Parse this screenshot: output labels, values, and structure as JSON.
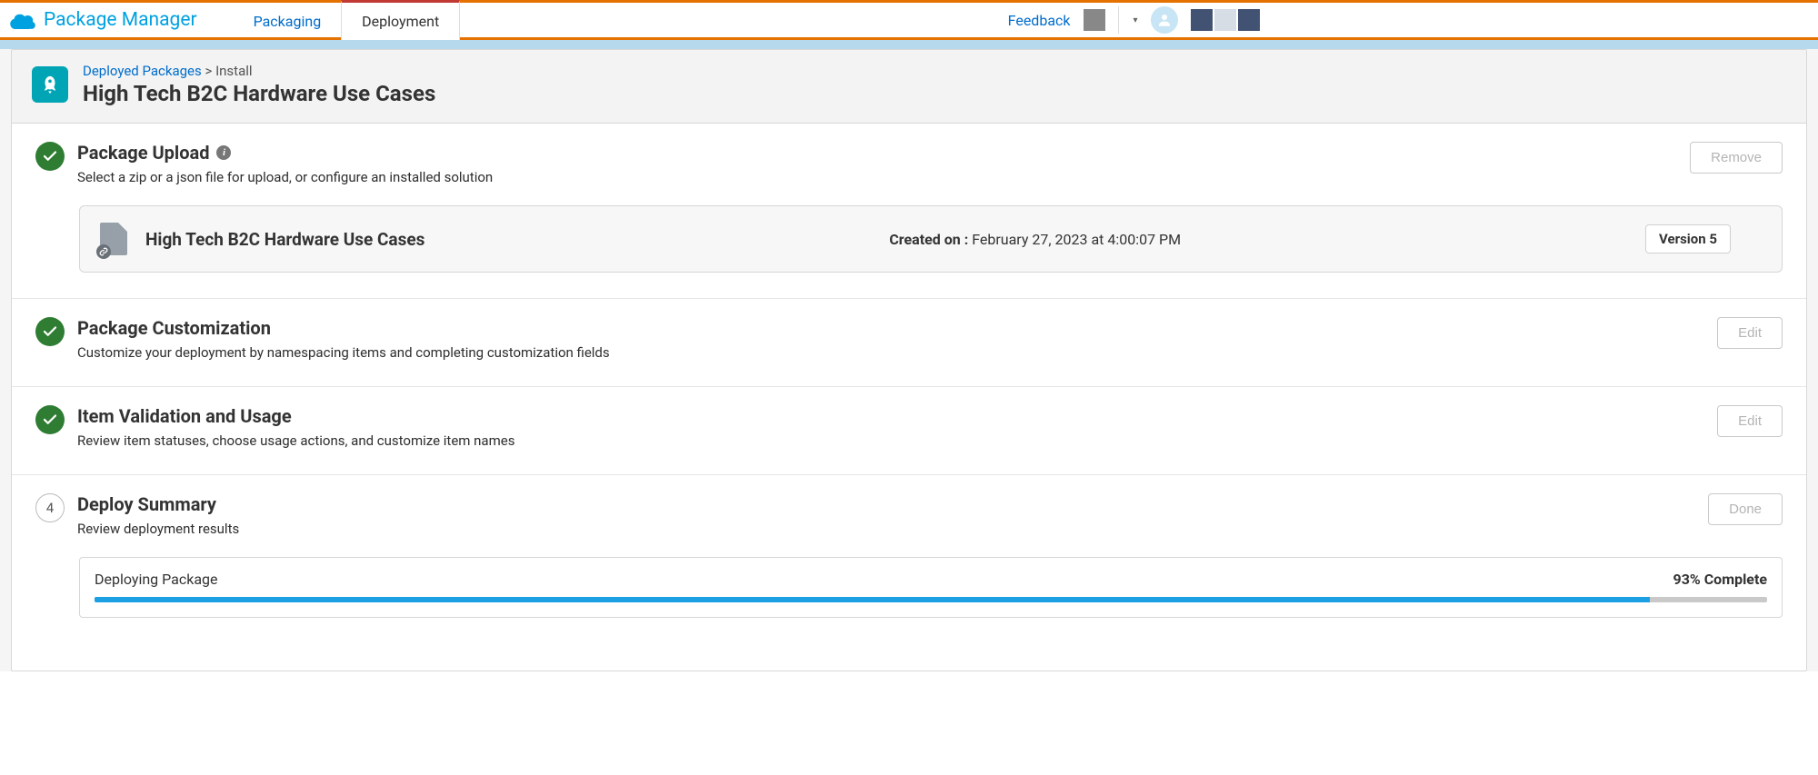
{
  "app": {
    "title": "Package Manager"
  },
  "nav": {
    "tabs": [
      {
        "label": "Packaging",
        "active": false
      },
      {
        "label": "Deployment",
        "active": true
      }
    ],
    "feedback": "Feedback"
  },
  "header": {
    "crumb_root": "Deployed Packages",
    "crumb_sep": ">",
    "crumb_leaf": "Install",
    "title": "High Tech B2C Hardware Use Cases"
  },
  "steps": [
    {
      "status": "done",
      "title": "Package Upload",
      "show_info": true,
      "desc": "Select a zip or a json file for upload, or configure an installed solution",
      "action_label": "Remove",
      "file": {
        "name": "High Tech B2C Hardware Use Cases",
        "meta_label": "Created on :",
        "meta_value": "February 27, 2023 at 4:00:07 PM",
        "version": "Version 5"
      }
    },
    {
      "status": "done",
      "title": "Package Customization",
      "desc": "Customize your deployment by namespacing items and completing customization fields",
      "action_label": "Edit"
    },
    {
      "status": "done",
      "title": "Item Validation and Usage",
      "desc": "Review item statuses, choose usage actions, and customize item names",
      "action_label": "Edit"
    },
    {
      "status": "num",
      "num": "4",
      "title": "Deploy Summary",
      "desc": "Review deployment results",
      "action_label": "Done",
      "deploy": {
        "label": "Deploying Package",
        "pct_text": "93% Complete",
        "pct": 93
      }
    }
  ]
}
